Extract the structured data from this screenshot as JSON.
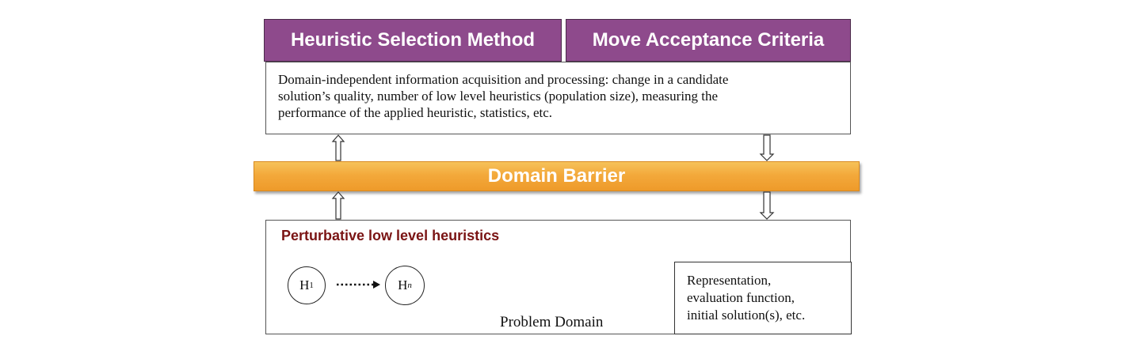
{
  "header": {
    "left": "Heuristic Selection Method",
    "right": "Move Acceptance Criteria"
  },
  "info": {
    "line1": "Domain-independent information acquisition and processing: change in a candidate",
    "line2": "solution’s quality, number of low level heuristics (population size), measuring the",
    "line3": "performance of the applied heuristic, statistics, etc."
  },
  "barrier": {
    "label": "Domain Barrier"
  },
  "domain": {
    "title": "Perturbative low level heuristics",
    "node_first": {
      "letter": "H",
      "sub": "1"
    },
    "node_last": {
      "letter": "H",
      "sub": "n"
    },
    "repr": {
      "line1": "Representation,",
      "line2": "evaluation function,",
      "line3": "initial solution(s), etc."
    },
    "label": "Problem Domain"
  },
  "colors": {
    "header_bg": "#8e4a8c",
    "barrier": "#f3a93b",
    "title_text": "#7a1414"
  }
}
